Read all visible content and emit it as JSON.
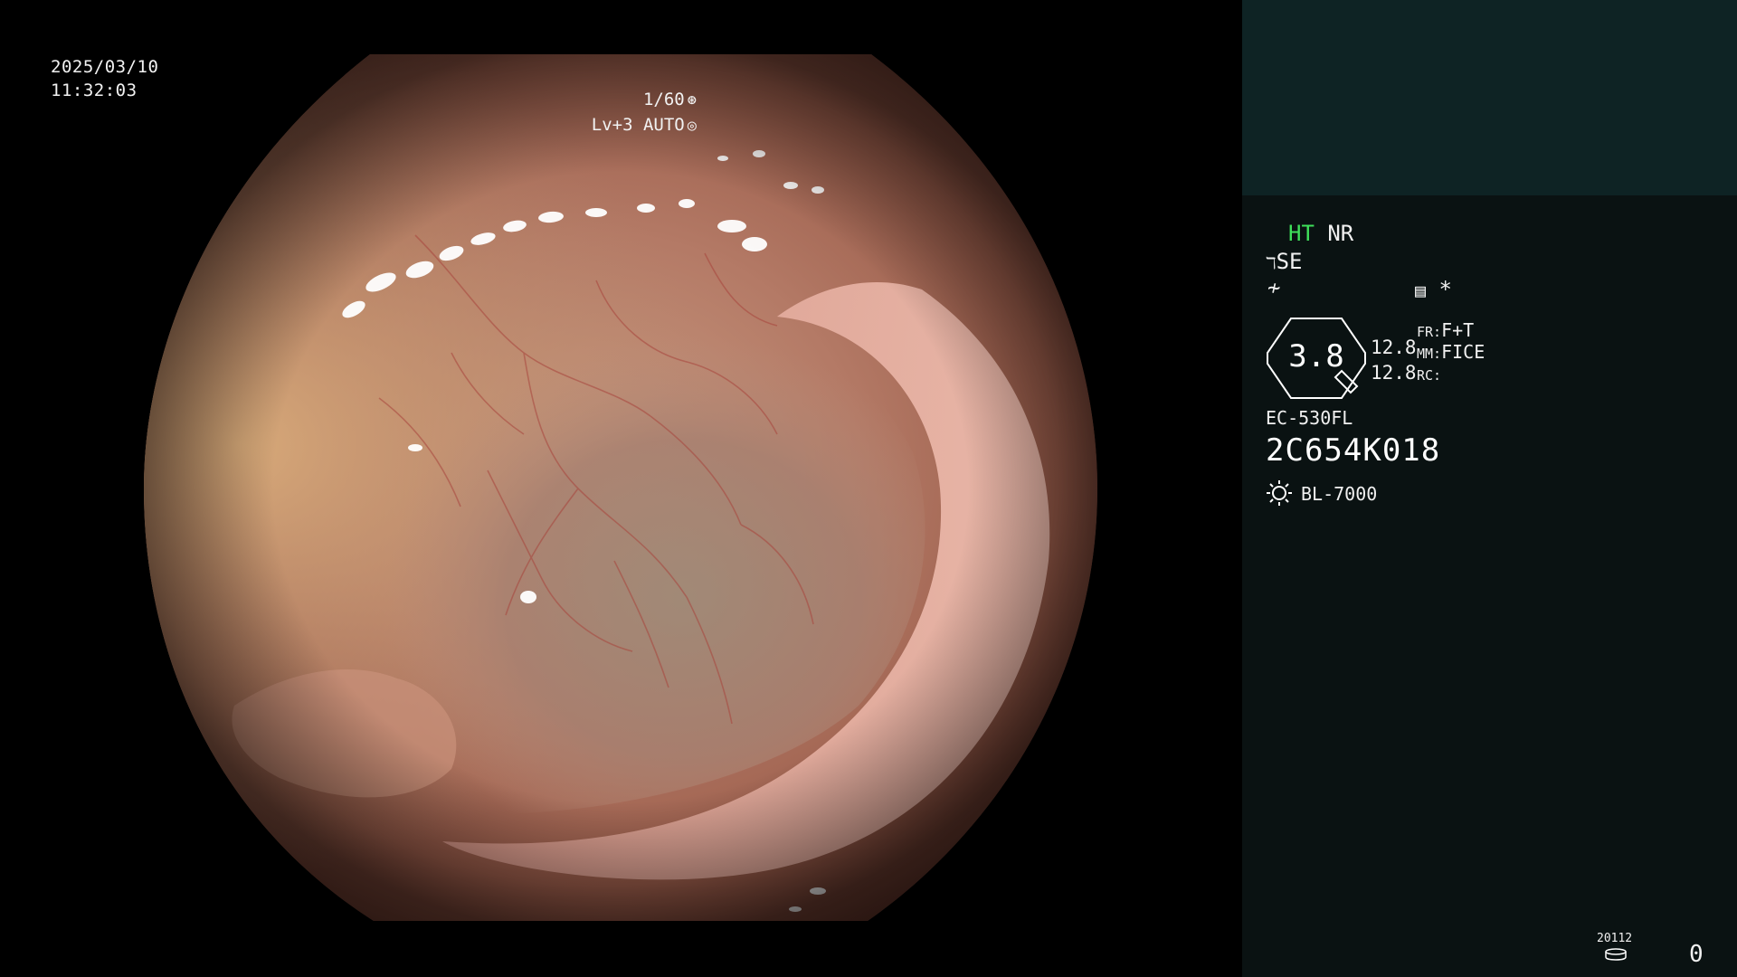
{
  "overlay": {
    "date": "2025/03/10",
    "time": "11:32:03",
    "shutter": "1/60",
    "shutter_icon": "aperture-icon",
    "level": "Lv+3 AUTO",
    "level_icon": "iris-icon"
  },
  "panel": {
    "ht_label": "HT",
    "nr_label": "NR",
    "structure_enhancement": "SE",
    "color_mode_icon": "fice-settings-icon",
    "asterisk": "*",
    "magnification": "3.8",
    "value_1": "12.8",
    "value_2": "12.8",
    "fr_label": "FR:",
    "fr_value": "F+T",
    "mm_label": "MM:",
    "mm_value": "FICE",
    "rc_label": "RC:",
    "rc_value": "",
    "scope_model": "EC-530FL",
    "serial_number": "2C654K018",
    "light_source": "BL-7000",
    "storage_code": "20112",
    "storage_count": "0"
  },
  "colors": {
    "panel_background": "#0a1212",
    "panel_top_background": "#0e2324",
    "ht_green": "#3fe05a"
  }
}
